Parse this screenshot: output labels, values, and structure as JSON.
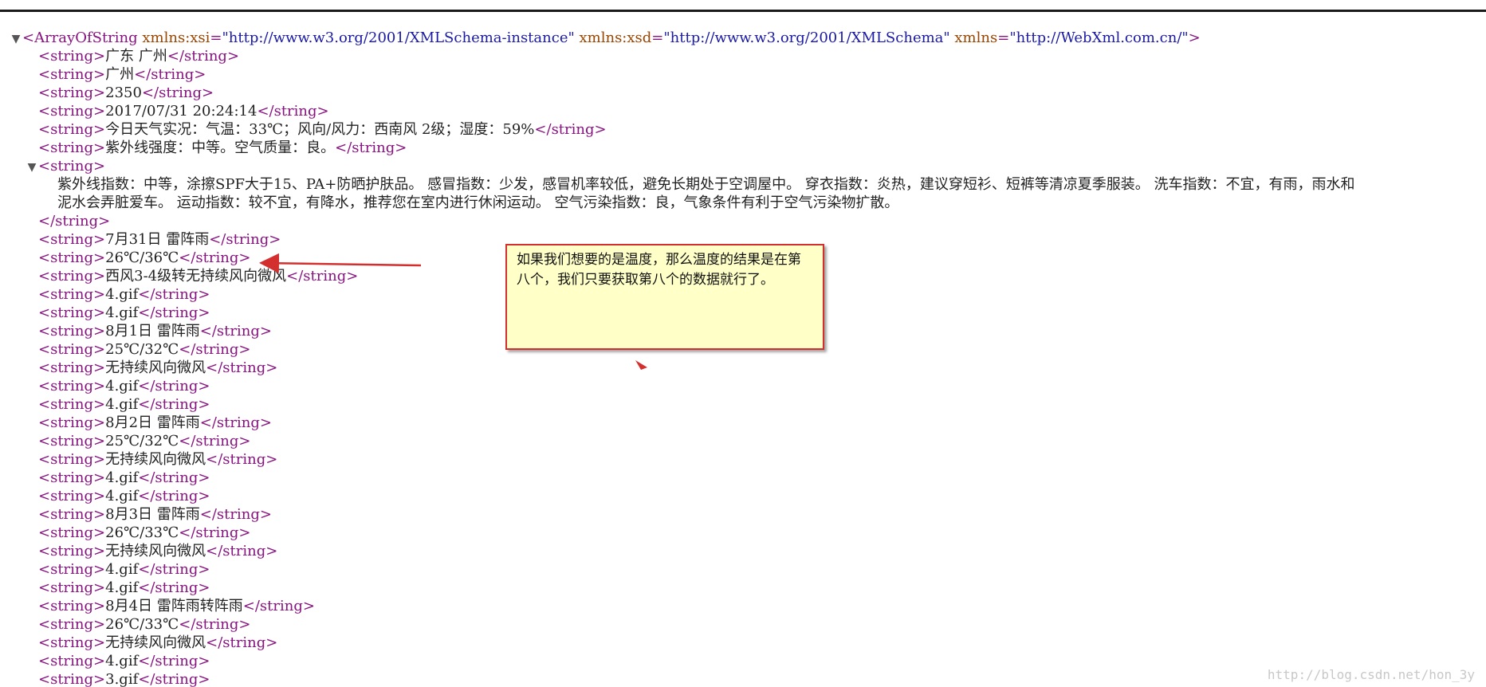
{
  "root": {
    "open": "<ArrayOfString",
    "attrs": [
      {
        "name": "xmlns:xsi",
        "value": "\"http://www.w3.org/2001/XMLSchema-instance\""
      },
      {
        "name": "xmlns:xsd",
        "value": "\"http://www.w3.org/2001/XMLSchema\""
      },
      {
        "name": "xmlns",
        "value": "\"http://WebXml.com.cn/\""
      }
    ],
    "close": ">",
    "toggle": "▼"
  },
  "items_before": [
    "广东 广州",
    "广州",
    "2350",
    "2017/07/31 20:24:14",
    "今日天气实况：气温：33℃；风向/风力：西南风 2级；湿度：59%",
    "紫外线强度：中等。空气质量：良。"
  ],
  "multiline": {
    "toggle": "▼",
    "open": "<string>",
    "line1": "紫外线指数：中等，涂擦SPF大于15、PA+防晒护肤品。 感冒指数：少发，感冒机率较低，避免长期处于空调屋中。 穿衣指数：炎热，建议穿短衫、短裤等清凉夏季服装。 洗车指数：不宜，有雨，雨水和",
    "line2": "泥水会弄脏爱车。 运动指数：较不宜，有降水，推荐您在室内进行休闲运动。 空气污染指数：良，气象条件有利于空气污染物扩散。",
    "close": "</string>"
  },
  "items_after": [
    "7月31日 雷阵雨",
    "26℃/36℃",
    "西风3-4级转无持续风向微风",
    "4.gif",
    "4.gif",
    "8月1日 雷阵雨",
    "25℃/32℃",
    "无持续风向微风",
    "4.gif",
    "4.gif",
    "8月2日 雷阵雨",
    "25℃/32℃",
    "无持续风向微风",
    "4.gif",
    "4.gif",
    "8月3日 雷阵雨",
    "26℃/33℃",
    "无持续风向微风",
    "4.gif",
    "4.gif",
    "8月4日 雷阵雨转阵雨",
    "26℃/33℃",
    "无持续风向微风",
    "4.gif",
    "3.gif"
  ],
  "tags": {
    "open": "<string>",
    "close": "</string>"
  },
  "annotation": {
    "text": "如果我们想要的是温度，那么温度的结果是在第八个，我们只要获取第八个的数据就行了。"
  },
  "watermark": "http://blog.csdn.net/hon_3y",
  "colors": {
    "tag": "#881280",
    "attr_name": "#994500",
    "attr_value": "#1a1aa6",
    "arrow": "#d32f2f",
    "callout_bg": "#ffffc8"
  }
}
